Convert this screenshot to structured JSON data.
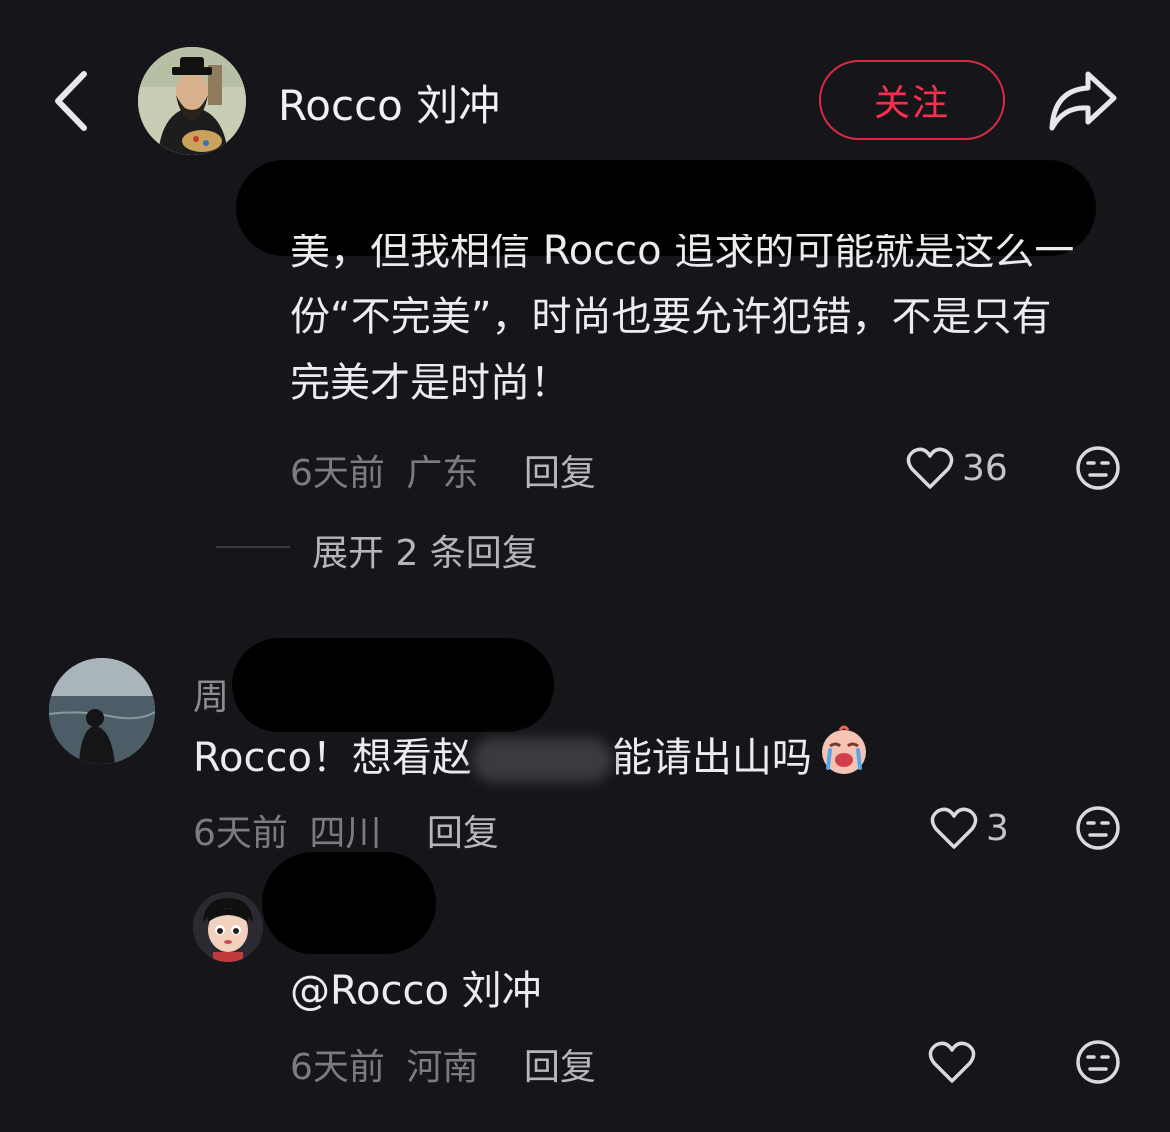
{
  "header": {
    "title": "Rocco 刘冲",
    "follow_label": "关注"
  },
  "comment1": {
    "text_line1": "美，但我相信 Rocco 追求的可能就是这么一",
    "text_line2": "份“不完美”，时尚也要允许犯错，不是只有",
    "text_line3": "完美才是时尚！",
    "time": "6天前",
    "location": "广东",
    "reply_label": "回复",
    "likes": "36"
  },
  "expand": {
    "label": "展开 2 条回复"
  },
  "comment2": {
    "username_prefix": "周",
    "text_start": "Rocco！想看赵",
    "text_end": "能请出山吗",
    "time": "6天前",
    "location": "四川",
    "reply_label": "回复",
    "likes": "3"
  },
  "comment3": {
    "text": "@Rocco 刘冲",
    "time": "6天前",
    "location": "河南",
    "reply_label": "回复"
  },
  "colors": {
    "background": "#16161a",
    "accent": "#ff2d4f",
    "meta": "#7b7b82"
  },
  "icons": [
    "back-icon",
    "share-icon",
    "heart-icon",
    "face-icon"
  ]
}
